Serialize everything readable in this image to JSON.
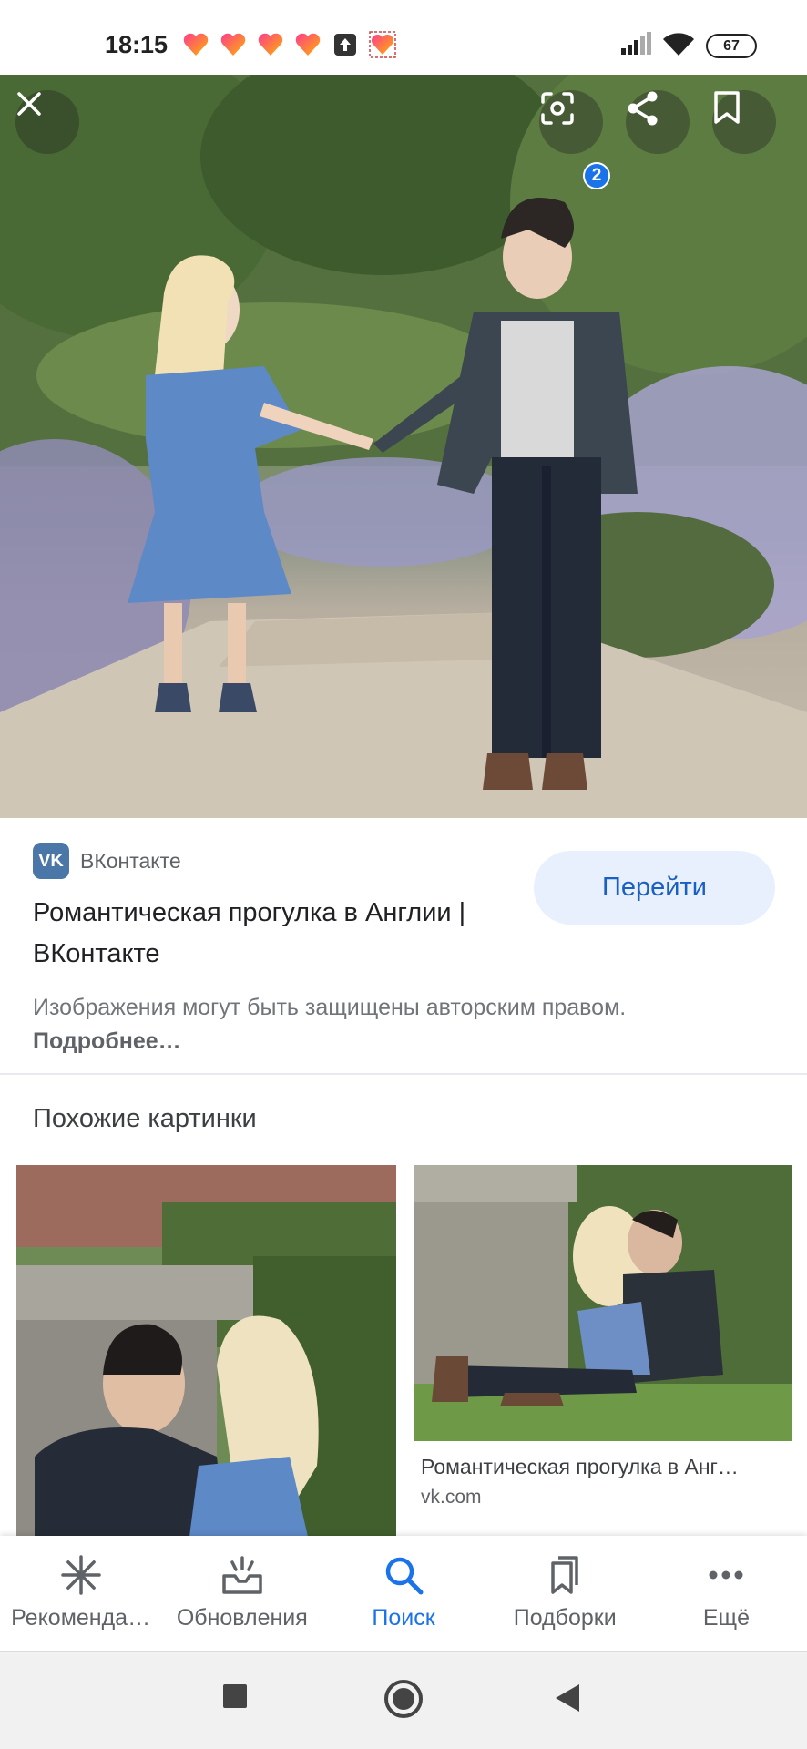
{
  "status_bar": {
    "time": "18:15",
    "battery": "67",
    "notification_icons": [
      "heart-app-icon",
      "heart-app-icon",
      "heart-app-icon",
      "heart-app-icon",
      "upload-icon",
      "heart-app-icon"
    ],
    "system_icons": [
      "signal-icon",
      "wifi-icon",
      "battery-icon"
    ]
  },
  "viewer": {
    "lens_badge": "2",
    "buttons": [
      "close-icon",
      "lens-icon",
      "share-icon",
      "bookmark-icon"
    ]
  },
  "result": {
    "source_logo": "VK",
    "source_name": "ВКонтакте",
    "title": "Романтическая прогулка в Англии | ВКонтакте",
    "go_button": "Перейти",
    "copyright_text": "Изображения могут быть защищены авторским правом.",
    "more_link": "Подробнее…"
  },
  "similar": {
    "heading": "Похожие картинки",
    "items": [
      {
        "caption": "",
        "domain": ""
      },
      {
        "caption": "Романтическая прогулка в Анг…",
        "domain": "vk.com"
      }
    ]
  },
  "bottom_nav": {
    "items": [
      {
        "label": "Рекоменда…",
        "icon": "asterisk-icon",
        "active": false
      },
      {
        "label": "Обновления",
        "icon": "inbox-updates-icon",
        "active": false
      },
      {
        "label": "Поиск",
        "icon": "search-icon",
        "active": true
      },
      {
        "label": "Подборки",
        "icon": "collections-icon",
        "active": false
      },
      {
        "label": "Ещё",
        "icon": "more-dots-icon",
        "active": false
      }
    ]
  },
  "colors": {
    "accent": "#1a73e8",
    "go_button_bg": "#e8f0fe",
    "vk_brand": "#4a76a8"
  }
}
